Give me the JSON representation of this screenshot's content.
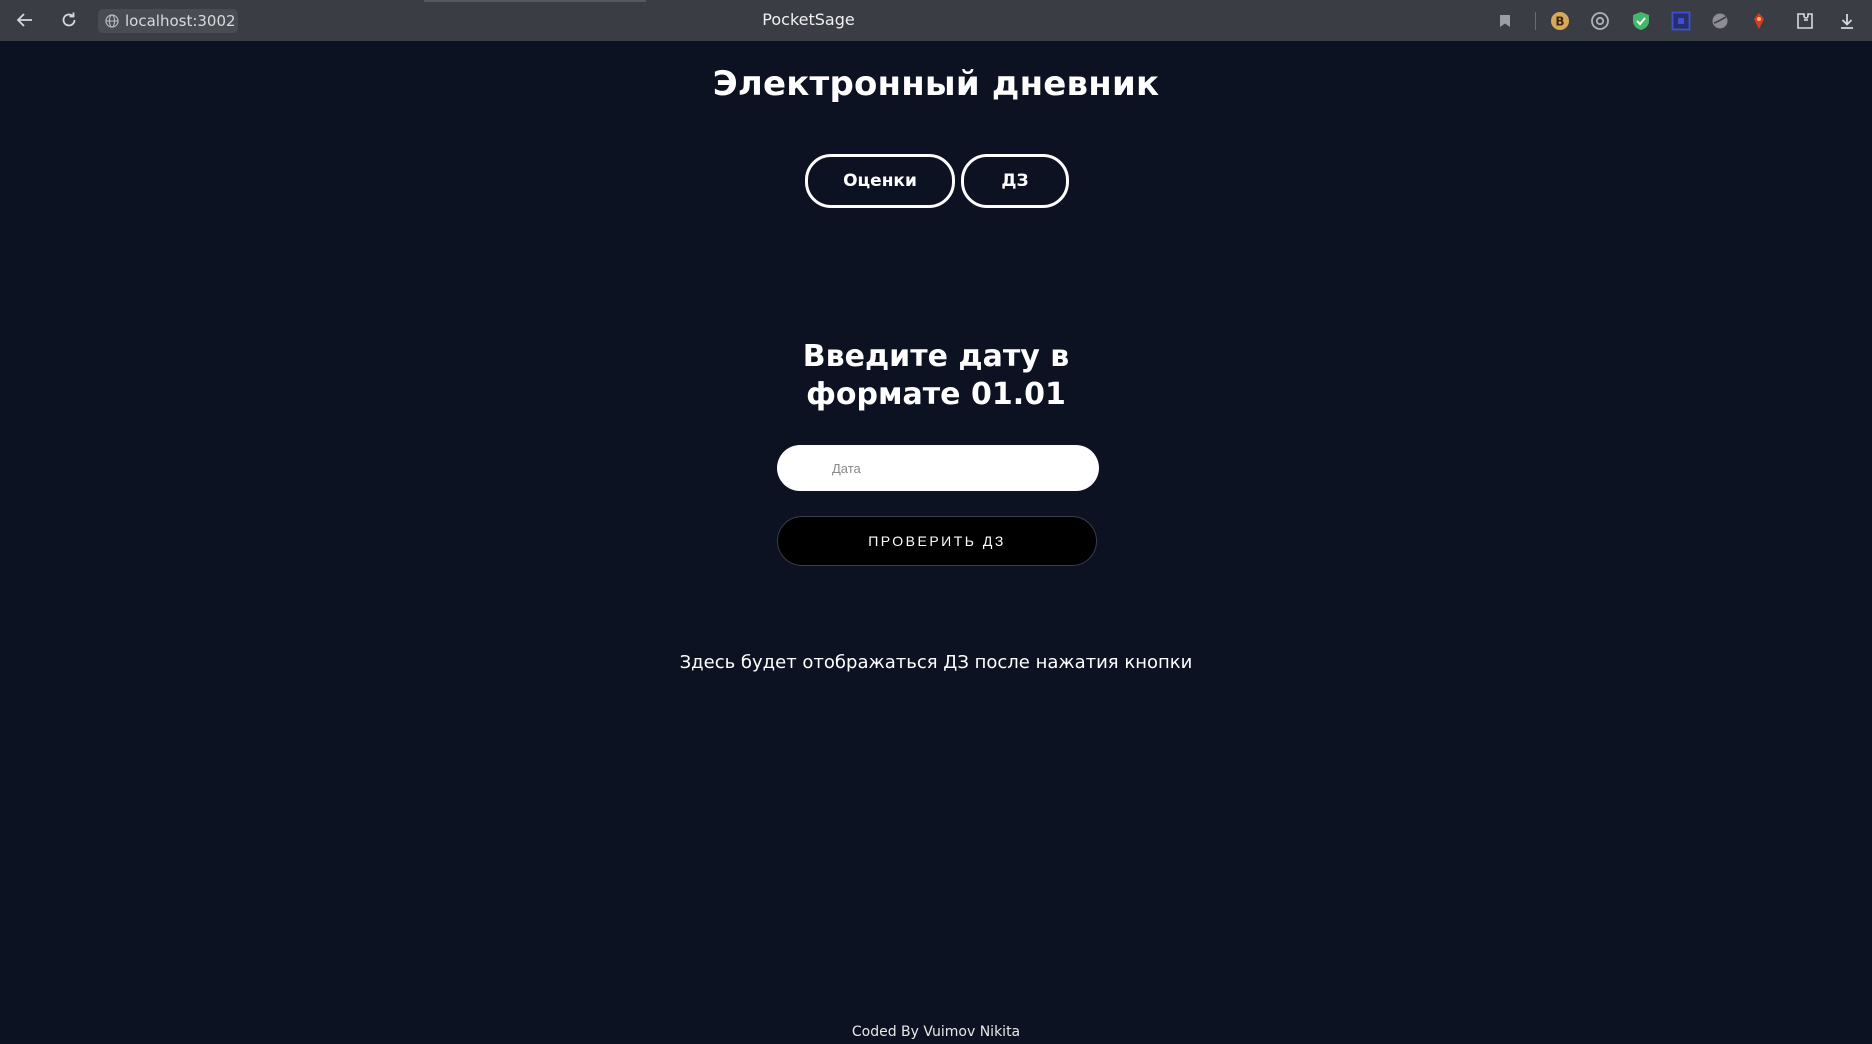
{
  "browser": {
    "url": "localhost:3002",
    "window_title": "PocketSage",
    "extensions": [
      "bookmark-icon",
      "b-extension-icon",
      "at-sign-icon",
      "shield-check-icon",
      "square-extension-icon",
      "ball-icon",
      "rocket-icon",
      "extensions-puzzle-icon",
      "download-icon"
    ]
  },
  "page": {
    "title": "Электронный дневник",
    "nav": {
      "grades_label": "Оценки",
      "homework_label": "ДЗ"
    },
    "prompt_line1": "Введите дату в",
    "prompt_line2": "формате 01.01",
    "date_input": {
      "placeholder": "Дата",
      "value": ""
    },
    "check_button_label": "ПРОВЕРИТЬ ДЗ",
    "result_text": "Здесь будет отображаться ДЗ после нажатия кнопки",
    "footer": "Coded By Vuimov Nikita"
  },
  "colors": {
    "background": "#0d1222",
    "chrome": "#3b3d45",
    "accent": "#ffffff",
    "button": "#000000"
  }
}
